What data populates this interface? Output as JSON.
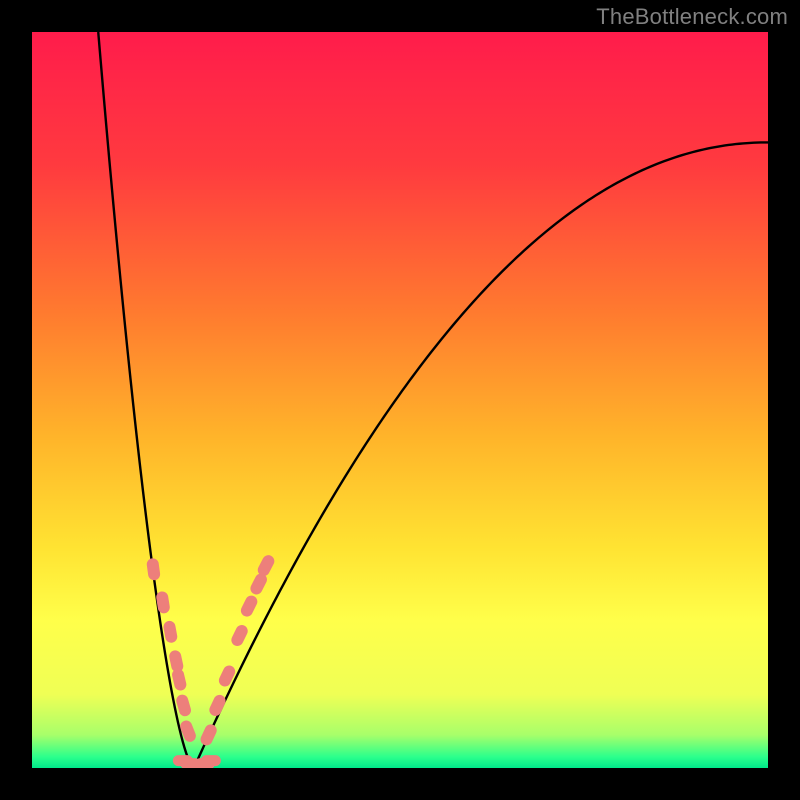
{
  "watermark": "TheBottleneck.com",
  "colors": {
    "bg": "#000000",
    "curve": "#000000",
    "marker": "#ED7F7B",
    "gradient_stops": [
      {
        "offset": 0.0,
        "color": "#FF1C4B"
      },
      {
        "offset": 0.18,
        "color": "#FF3A3F"
      },
      {
        "offset": 0.38,
        "color": "#FF7A2F"
      },
      {
        "offset": 0.55,
        "color": "#FFB42A"
      },
      {
        "offset": 0.7,
        "color": "#FFE332"
      },
      {
        "offset": 0.8,
        "color": "#FFFF4A"
      },
      {
        "offset": 0.9,
        "color": "#EFFF55"
      },
      {
        "offset": 0.955,
        "color": "#A8FF6A"
      },
      {
        "offset": 0.985,
        "color": "#2BFF8C"
      },
      {
        "offset": 1.0,
        "color": "#00E88A"
      }
    ]
  },
  "chart_data": {
    "type": "line",
    "title": "",
    "xlabel": "",
    "ylabel": "",
    "xlim": [
      0,
      100
    ],
    "ylim": [
      0,
      100
    ],
    "legend": false,
    "grid": false,
    "curve": {
      "x_min_at": 22,
      "left_branch": {
        "x_range": [
          9,
          22
        ],
        "y_at_x9": 100,
        "y_at_x22": 0,
        "shape": "steep concave descent"
      },
      "right_branch": {
        "x_range": [
          22,
          100
        ],
        "y_at_x22": 0,
        "y_at_x100": 85,
        "shape": "concave ascent flattening toward right"
      }
    },
    "series": [
      {
        "name": "markers-left",
        "type": "scatter",
        "x": [
          16.5,
          17.8,
          18.8,
          19.6,
          20.0,
          20.6,
          21.2
        ],
        "y": [
          27.0,
          22.5,
          18.5,
          14.5,
          12.0,
          8.5,
          5.0
        ]
      },
      {
        "name": "markers-right",
        "type": "scatter",
        "x": [
          24.0,
          25.2,
          26.5,
          28.2,
          29.5,
          30.8,
          31.8
        ],
        "y": [
          4.5,
          8.5,
          12.5,
          18.0,
          22.0,
          25.0,
          27.5
        ]
      },
      {
        "name": "markers-bottom",
        "type": "scatter",
        "x": [
          20.5,
          21.5,
          22.5,
          23.5,
          24.3
        ],
        "y": [
          1.0,
          0.6,
          0.5,
          0.6,
          1.0
        ]
      }
    ]
  }
}
